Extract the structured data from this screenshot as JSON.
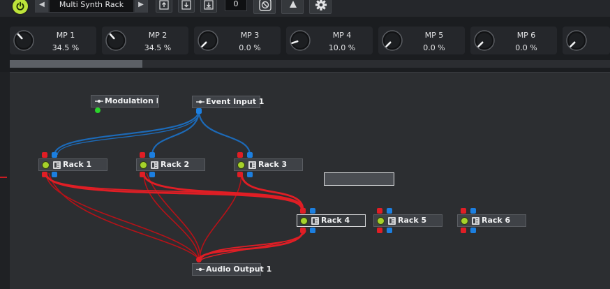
{
  "toolbar": {
    "preset_name": "Multi Synth Rack",
    "prev_arrow": "◀",
    "next_arrow": "▶",
    "counter": "0"
  },
  "macros": [
    {
      "label": "MP 1",
      "value": "34.5 %",
      "level": 0.345
    },
    {
      "label": "MP 2",
      "value": "34.5 %",
      "level": 0.345
    },
    {
      "label": "MP 3",
      "value": "0.0 %",
      "level": 0.0
    },
    {
      "label": "MP 4",
      "value": "10.0 %",
      "level": 0.1
    },
    {
      "label": "MP 5",
      "value": "0.0 %",
      "level": 0.0
    },
    {
      "label": "MP 6",
      "value": "0.0 %",
      "level": 0.0
    },
    {
      "label": "",
      "value": "",
      "level": 0.0
    }
  ],
  "nodes": {
    "modulation_input": "Modulation Inpu",
    "event_input": "Event Input 1",
    "rack1": "Rack 1",
    "rack2": "Rack 2",
    "rack3": "Rack 3",
    "rack4": "Rack 4",
    "rack5": "Rack 5",
    "rack6": "Rack 6",
    "audio_output": "Audio Output 1"
  },
  "colors": {
    "accent": "#bde33a",
    "audio_wire": "#e01e25",
    "event_wire": "#1c7fe0",
    "modulation_pin": "#2bd42b"
  }
}
